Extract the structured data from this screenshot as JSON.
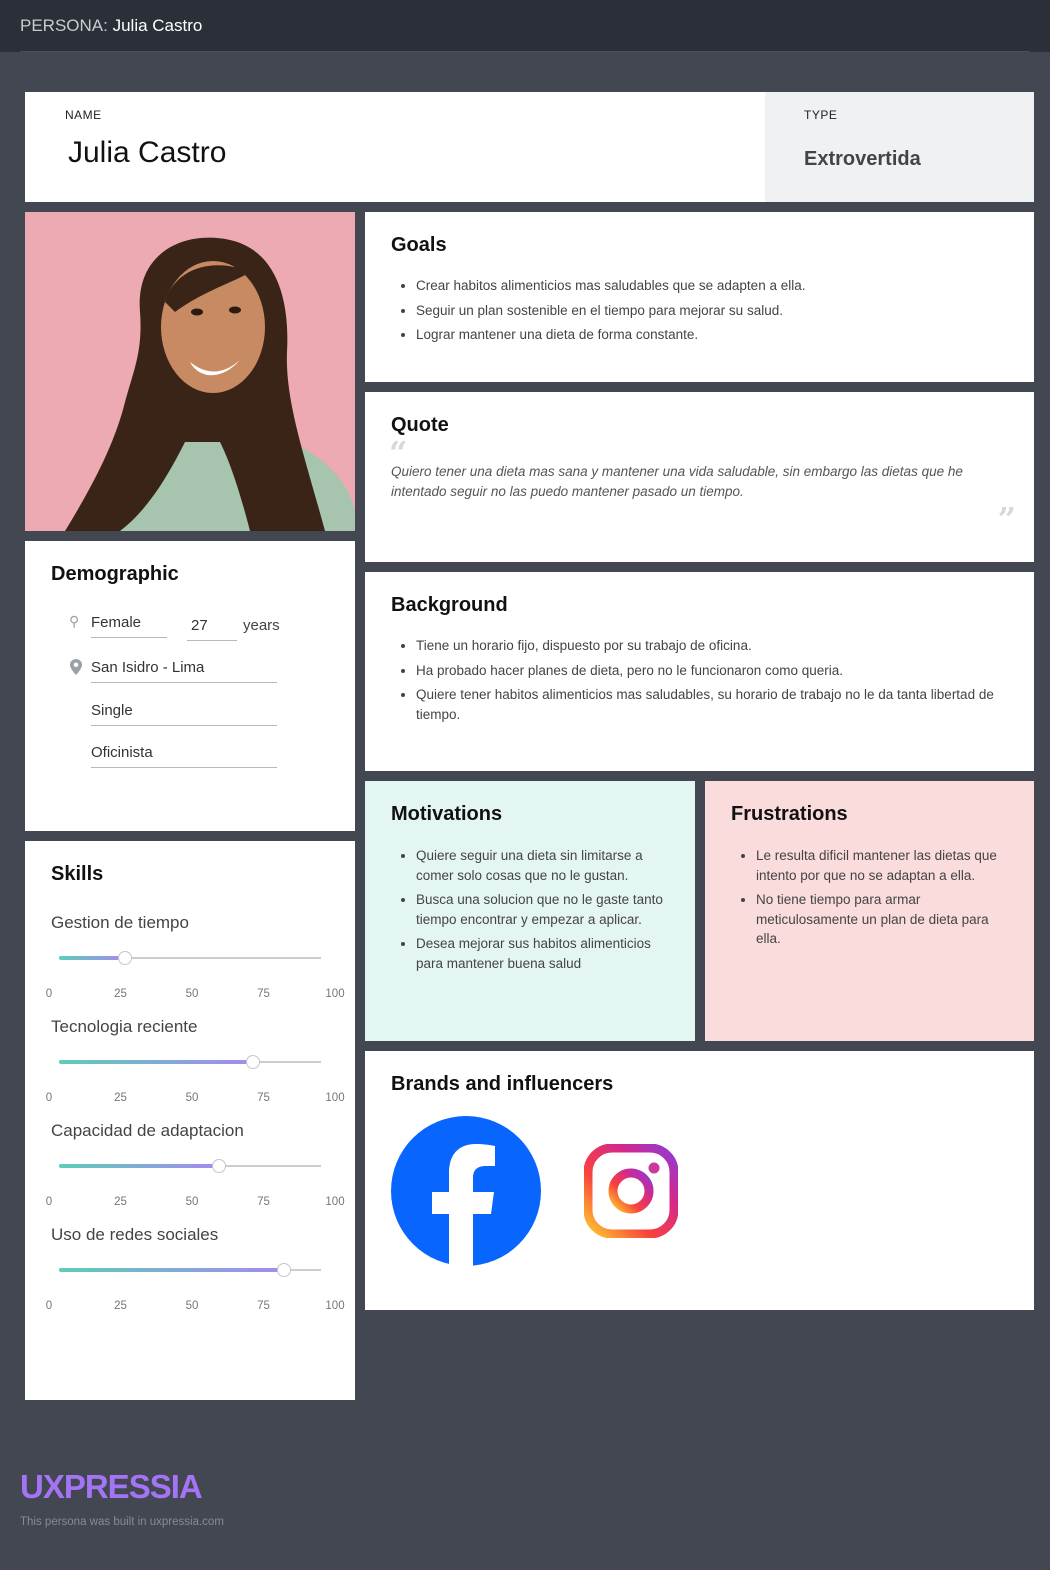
{
  "topbar": {
    "prefix": "PERSONA:",
    "persona_name": "Julia Castro"
  },
  "header": {
    "name_label": "NAME",
    "name_value": "Julia Castro",
    "type_label": "TYPE",
    "type_value": "Extrovertida"
  },
  "goals": {
    "title": "Goals",
    "items": [
      "Crear habitos alimenticios mas saludables que se adapten a ella.",
      "Seguir un plan sostenible en el tiempo para mejorar su salud.",
      "Lograr mantener una dieta de forma constante."
    ]
  },
  "quote": {
    "title": "Quote",
    "text": "Quiero tener una dieta mas sana y mantener una vida saludable, sin embargo las dietas que he intentado seguir no las puedo mantener pasado un tiempo."
  },
  "background": {
    "title": "Background",
    "items": [
      "Tiene un horario fijo, dispuesto por su trabajo de oficina.",
      "Ha probado hacer planes de dieta, pero no le funcionaron como queria.",
      "Quiere tener habitos alimenticios mas saludables, su horario de trabajo no le da tanta libertad de tiempo."
    ]
  },
  "motivations": {
    "title": "Motivations",
    "items": [
      "Quiere seguir una dieta sin limitarse a comer solo cosas que no le gustan.",
      "Busca una solucion que no le gaste tanto tiempo encontrar y empezar a aplicar.",
      "Desea mejorar sus habitos alimenticios para mantener buena salud"
    ]
  },
  "frustrations": {
    "title": "Frustrations",
    "items": [
      "Le resulta dificil mantener las dietas que intento por que no se adaptan a ella.",
      "No tiene tiempo para armar meticulosamente un plan de dieta para ella."
    ]
  },
  "brands": {
    "title": "Brands and influencers",
    "logos": [
      "facebook-logo",
      "instagram-logo"
    ]
  },
  "demographic": {
    "title": "Demographic",
    "gender": "Female",
    "age": "27",
    "age_unit": "years",
    "location": "San Isidro - Lima",
    "status": "Single",
    "occupation": "Oficinista"
  },
  "skills": {
    "title": "Skills",
    "ticks": [
      "0",
      "25",
      "50",
      "75",
      "100"
    ],
    "items": [
      {
        "label": "Gestion de tiempo",
        "value": 25
      },
      {
        "label": "Tecnologia reciente",
        "value": 74
      },
      {
        "label": "Capacidad de adaptacion",
        "value": 61
      },
      {
        "label": "Uso de redes sociales",
        "value": 86
      }
    ]
  },
  "colors": {
    "background": "#434751",
    "topbar": "#2b2f37",
    "brand": "#a374f6",
    "motivations_bg": "#e4f6f2",
    "frustrations_bg": "#f9dcdb"
  },
  "footer": {
    "logo_text": "UXPRESSIA",
    "note": "This persona was built in uxpressia.com"
  }
}
